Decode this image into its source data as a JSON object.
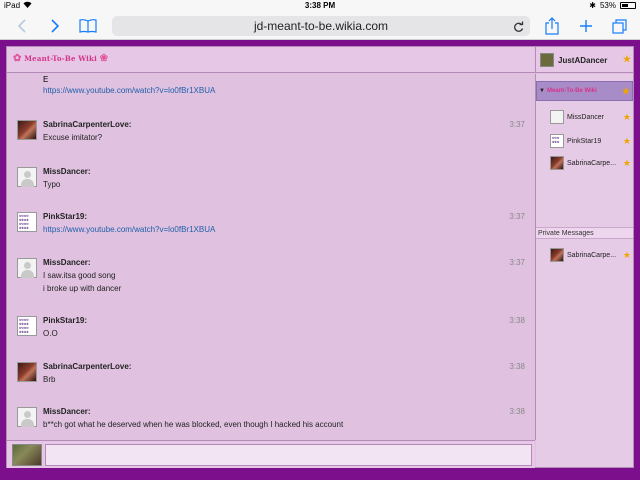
{
  "statusbar": {
    "device": "iPad",
    "time": "3:38 PM",
    "battery": "53%",
    "battery_level": 0.53
  },
  "browser": {
    "url": "jd-meant-to-be.wikia.com"
  },
  "header": {
    "wiki_logo": "Meant-To-Be Wiki",
    "current_user": "JustADancer"
  },
  "messages": {
    "continuation": {
      "line1": "E",
      "link": "https://www.youtube.com/watch?v=lo0fBr1XBUA"
    },
    "items": [
      {
        "user": "SabrinaCarpenterLove:",
        "time": "3:37",
        "line1": "Excuse imitator?",
        "line2": ""
      },
      {
        "user": "MissDancer:",
        "time": "",
        "line1": "Typo",
        "line2": ""
      },
      {
        "user": "PinkStar19:",
        "time": "3:37",
        "line1": "https://www.youtube.com/watch?v=lo0fBr1XBUA",
        "line2": ""
      },
      {
        "user": "MissDancer:",
        "time": "3:37",
        "line1": "I saw.itsa good song",
        "line2": "i broke up with dancer"
      },
      {
        "user": "PinkStar19:",
        "time": "3:38",
        "line1": "O.O",
        "line2": ""
      },
      {
        "user": "SabrinaCarpenterLove:",
        "time": "3:38",
        "line1": "Brb",
        "line2": ""
      },
      {
        "user": "MissDancer:",
        "time": "3:38",
        "line1": "b**ch got what he deserved when he was blocked, even though I hacked his account",
        "line2": ""
      }
    ]
  },
  "sidebar": {
    "room_label": "Meant-To-Be Wiki",
    "users": [
      "MissDancer",
      "PinkStar19",
      "SabrinaCarpe..."
    ],
    "pm_header": "Private Messages",
    "pm_users": [
      "SabrinaCarpe..."
    ]
  },
  "colors": {
    "accent": "#7b0f8c",
    "panel": "#e0c2e0",
    "link": "#1f5fa8",
    "star": "#f0a400"
  }
}
